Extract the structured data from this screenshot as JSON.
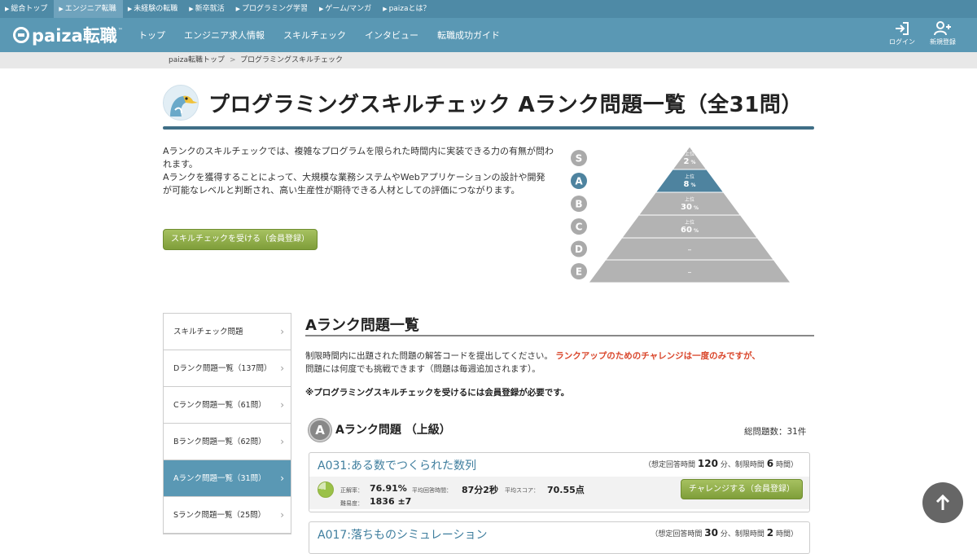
{
  "topbar": {
    "items": [
      {
        "label": "総合トップ"
      },
      {
        "label": "エンジニア転職"
      },
      {
        "label": "未経験の転職"
      },
      {
        "label": "新卒就活"
      },
      {
        "label": "プログラミング学習"
      },
      {
        "label": "ゲーム/マンガ"
      },
      {
        "label": "paizaとは？"
      }
    ]
  },
  "header": {
    "logo_text": "paiza転職",
    "nav": [
      {
        "label": "トップ"
      },
      {
        "label": "エンジニア求人情報"
      },
      {
        "label": "スキルチェック"
      },
      {
        "label": "インタビュー"
      },
      {
        "label": "転職成功ガイド"
      }
    ],
    "login_label": "ログイン",
    "register_label": "新規登録"
  },
  "breadcrumb": {
    "home": "paiza転職トップ",
    "separator": ">",
    "current": "プログラミングスキルチェック"
  },
  "page": {
    "title": "プログラミングスキルチェック Aランク問題一覧（全31問）",
    "intro_1": "Aランクのスキルチェックでは、複雑なプログラムを限られた時間内に実装できる力の有無が問われます。",
    "intro_2": "Aランクを獲得することによって、大規模な業務システムやWebアプリケーションの設計や開発が可能なレベルと判断され、高い生産性が期待できる人材としての評価につながります。",
    "cta_label": "スキルチェックを受ける（会員登録）"
  },
  "pyramid": {
    "ranks": [
      "S",
      "A",
      "B",
      "C",
      "D",
      "E"
    ],
    "selected": "A",
    "top_label": "上位",
    "tiers": [
      {
        "pct": "2",
        "unit": "%"
      },
      {
        "pct": "8",
        "unit": "%"
      },
      {
        "pct": "30",
        "unit": "%"
      },
      {
        "pct": "60",
        "unit": "%"
      },
      {
        "pct": "–",
        "unit": ""
      },
      {
        "pct": "–",
        "unit": ""
      }
    ],
    "colors": {
      "tier": "#b3b3b3",
      "selected": "#4e839f",
      "rank_circle": "#aaaaaa"
    }
  },
  "sidebar": {
    "items": [
      {
        "label": "スキルチェック問題"
      },
      {
        "label": "Dランク問題一覧（137問）"
      },
      {
        "label": "Cランク問題一覧（61問）"
      },
      {
        "label": "Bランク問題一覧（62問）"
      },
      {
        "label": "Aランク問題一覧（31問）"
      },
      {
        "label": "Sランク問題一覧（25問）"
      }
    ],
    "selected_index": 4
  },
  "section": {
    "heading": "Aランク問題一覧",
    "desc_normal": "制限時間内に出題された問題の解答コードを提出してください。",
    "desc_red": "ランクアップのためのチャレンジは一度のみですが、",
    "desc_tail": "問題には何度でも挑戦できます（問題は毎週追加されます）。",
    "note": "※プログラミングスキルチェックを受けるには会員登録が必要です。",
    "badge": "A",
    "level_title": "Aランク問題 （上級）",
    "total": "総問題数：31件"
  },
  "problems": [
    {
      "title": "A031:ある数でつくられた数列",
      "time_pre": "（想定回答時間",
      "expected": "120",
      "time_mid": "分、制限時間",
      "limit": "6",
      "time_post": "時間）",
      "accuracy_label": "正解率：",
      "accuracy": "76.91%",
      "avg_time_label": "平均回答時間：",
      "avg_time": "87分2秒",
      "avg_score_label": "平均スコア：",
      "avg_score": "70.55点",
      "difficulty_label": "難易度：",
      "difficulty": "1836 ±7",
      "challenge_label": "チャレンジする（会員登録）",
      "accuracy_fraction": 0.7691
    },
    {
      "title": "A017:落ちものシミュレーション",
      "time_pre": "（想定回答時間",
      "expected": "30",
      "time_mid": "分、制限時間",
      "limit": "2",
      "time_post": "時間）"
    }
  ]
}
